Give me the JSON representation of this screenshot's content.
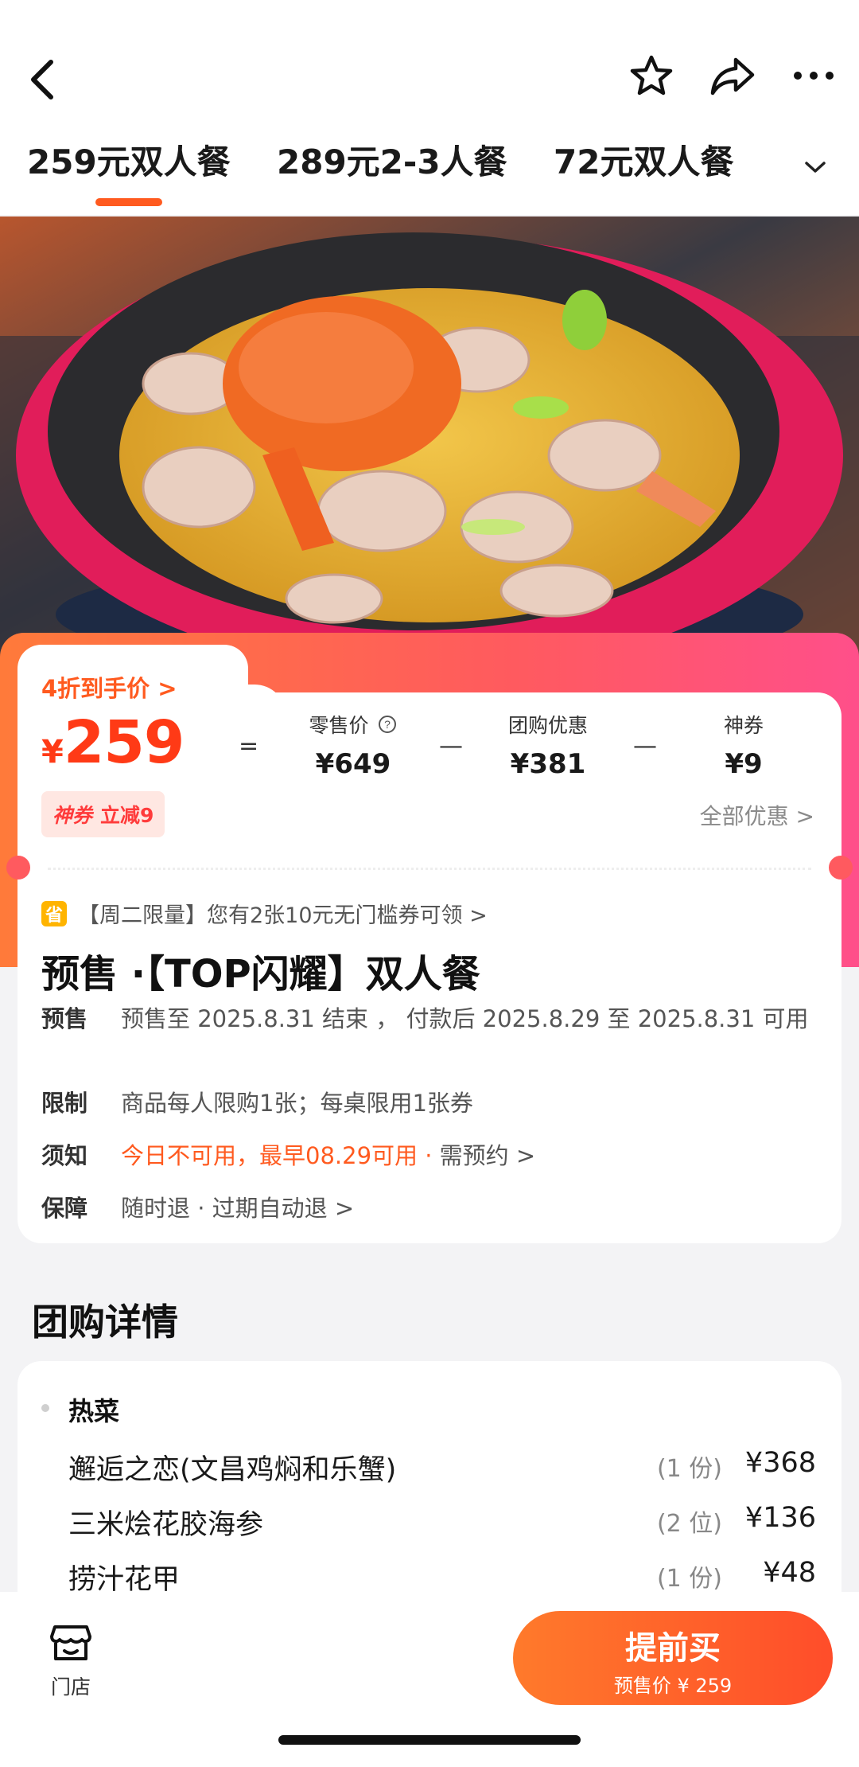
{
  "header": {
    "back_icon": "chevron-left-icon",
    "actions": [
      "star-icon",
      "share-icon",
      "more-icon"
    ]
  },
  "tabs": [
    {
      "label": "259元双人餐",
      "active": true
    },
    {
      "label": "289元2-3人餐",
      "active": false
    },
    {
      "label": "72元双人餐",
      "active": false
    }
  ],
  "price": {
    "tag": "4折到手价 >",
    "currency": "¥",
    "amount": "259",
    "equals": "=",
    "retail_label": "零售价",
    "retail_value": "¥649",
    "minus": "—",
    "group_label": "团购优惠",
    "group_value": "¥381",
    "coupon_label": "神券",
    "coupon_value": "¥9",
    "badge_a": "神券",
    "badge_b": "立减9",
    "all_offers": "全部优惠 >"
  },
  "deal": {
    "promo_icon": "省",
    "promo_text": "【周二限量】您有2张10元无门槛券可领 >",
    "title": "预售 ·【TOP闪耀】双人餐",
    "rows": [
      {
        "key": "预售",
        "value": "预售至 2025.8.31 结束 ， 付款后 2025.8.29 至 2025.8.31 可用"
      },
      {
        "key": "限制",
        "value": "商品每人限购1张；每桌限用1张券"
      },
      {
        "key": "须知",
        "value_orange": "今日不可用，最早08.29可用 ·",
        "value": " 需预约 >"
      },
      {
        "key": "保障",
        "value": "随时退 · 过期自动退 >"
      }
    ]
  },
  "details": {
    "section_title": "团购详情",
    "category": "热菜",
    "items": [
      {
        "name": "邂逅之恋(文昌鸡焖和乐蟹)",
        "qty": "(1 份)",
        "price": "¥368"
      },
      {
        "name": "三米烩花胶海参",
        "qty": "(2 位)",
        "price": "¥136"
      },
      {
        "name": "捞汁花甲",
        "qty": "(1 份)",
        "price": "¥48"
      }
    ]
  },
  "bottom": {
    "store_label": "门店",
    "buy_label": "提前买",
    "buy_sub": "预售价 ¥ 259"
  },
  "colors": {
    "accent": "#ff5a1f",
    "price_red": "#ff3a16",
    "gradient_start": "#ff7a3a",
    "gradient_end": "#ff4f8a"
  }
}
